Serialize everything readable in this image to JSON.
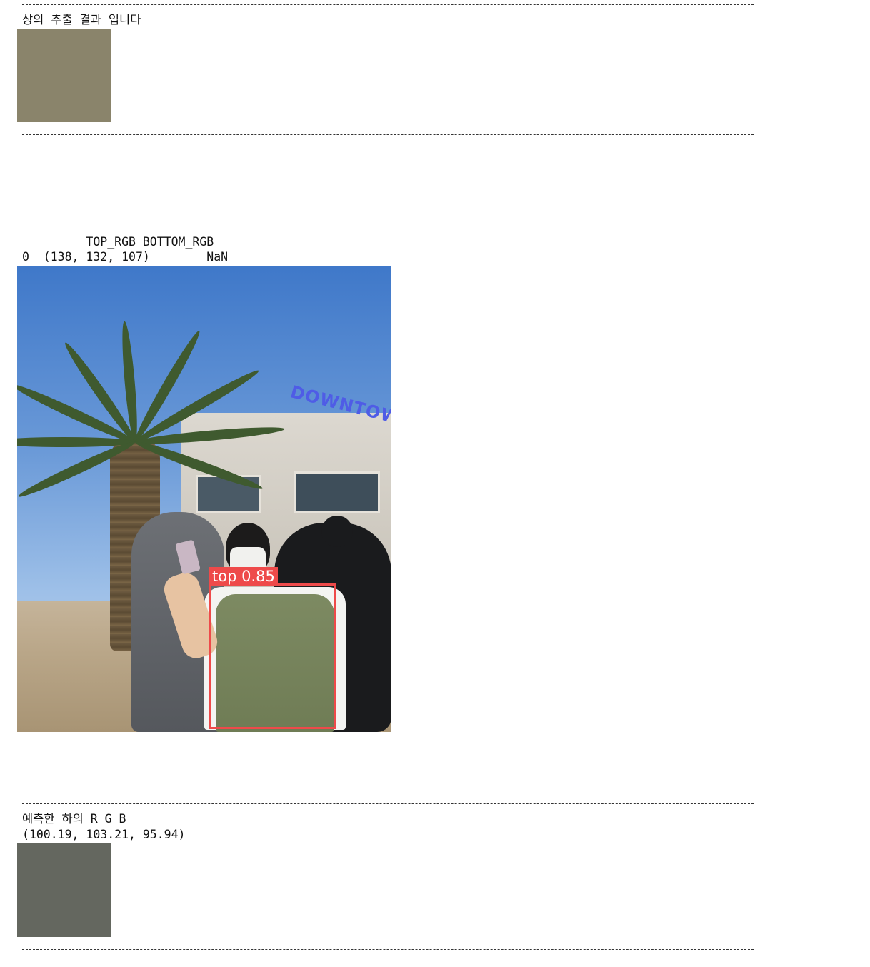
{
  "top_section": {
    "title": "상의 추출 결과 입니다",
    "swatch_color": "#8a846b"
  },
  "table": {
    "header": "         TOP_RGB BOTTOM_RGB",
    "row": "0  (138, 132, 107)        NaN"
  },
  "detection": {
    "label": "top 0.85",
    "box_color": "#ee4a4a",
    "sign_text": "DOWNTOWNER"
  },
  "bottom_section": {
    "title": "예측한 하의 R G B",
    "rgb_value": "(100.19, 103.21, 95.94)",
    "swatch_color": "#64675f"
  }
}
